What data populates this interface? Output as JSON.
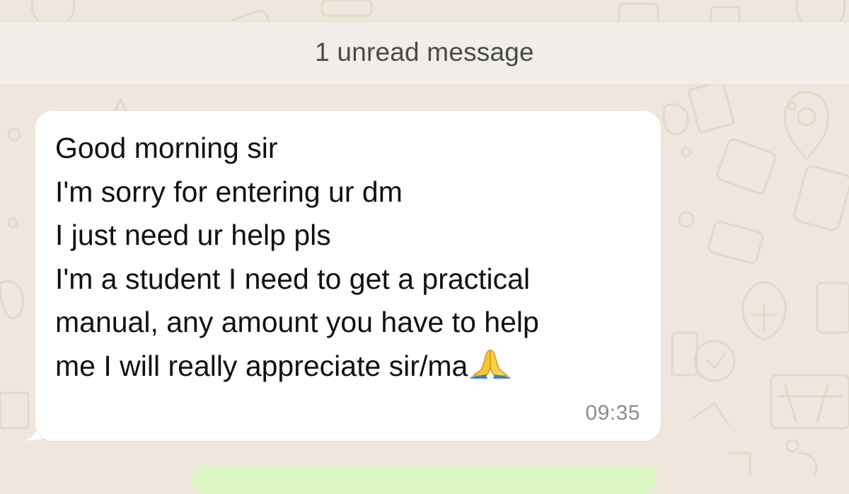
{
  "chat": {
    "unread_banner": "1 unread message",
    "incoming_message": {
      "lines": [
        "Good morning sir",
        "I'm sorry for entering ur dm",
        "I just need ur help pls",
        "I'm a student I need to get a practical",
        "manual, any amount you have to help",
        "me I will really appreciate sir/ma"
      ],
      "emoji": "folded-hands-emoji",
      "time": "09:35"
    }
  },
  "colors": {
    "wallpaper": "#efe7dd",
    "banner_background": "#f1eeea",
    "incoming_bubble": "#ffffff",
    "outgoing_bubble": "#dcf7c5",
    "timestamp": "#8c8c8c"
  }
}
